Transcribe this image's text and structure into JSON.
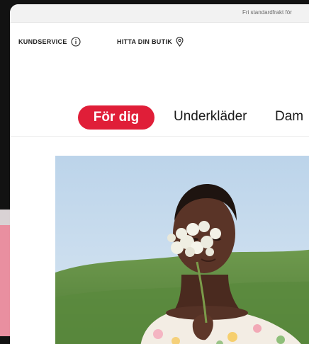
{
  "announcement": {
    "text": "Fri standardfrakt för"
  },
  "utility": {
    "customer_service": "KUNDSERVICE",
    "find_store": "HITTA DIN BUTIK"
  },
  "nav": {
    "items": [
      {
        "label": "För dig",
        "active": true
      },
      {
        "label": "Underkläder"
      },
      {
        "label": "Dam"
      }
    ]
  },
  "icons": {
    "customer_service": "info-circle-icon",
    "find_store": "location-pin-icon"
  },
  "colors": {
    "accent": "#e01e38",
    "text": "#1a1a1a",
    "topbar_bg": "#f2f2f2"
  }
}
